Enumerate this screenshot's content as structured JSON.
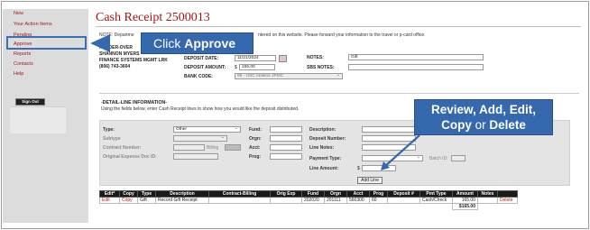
{
  "sidebar": {
    "items": [
      "New",
      "Your Action Items",
      "Pending",
      "Approve",
      "Reports",
      "Contacts",
      "Help"
    ],
    "signout_label": "Sign Out"
  },
  "page": {
    "title": "Cash Receipt 2500013",
    "note_prefix": "NOTE: Departme",
    "note_suffix": "ntered on this website. Please forward your information to the travel or p-card office."
  },
  "callouts": {
    "approve_prefix": "Click ",
    "approve_bold": "Approve",
    "review_line1": "Review, Add, Edit,",
    "review_copy": "Copy",
    "review_or": " or ",
    "review_delete": "Delete"
  },
  "header": {
    "section_label": "HEADER-OVER",
    "contact_name": "SHANNON MYERS",
    "contact_dept": "FINANCE SYSTEMS MGMT LRK",
    "contact_phone": "(806) 743-3604",
    "deposit_date_label": "DEPOSIT DATE:",
    "deposit_date_value": "11/21/2024",
    "deposit_amount_label": "DEPOSIT AMOUNT:",
    "deposit_amount_prefix": "$",
    "deposit_amount_value": "165.00",
    "bank_code_label": "BANK CODE:",
    "bank_code_value": "95 - HSC Abilene JPMC",
    "notes_label": "NOTES:",
    "notes_value": "Gift",
    "sbs_notes_label": "SBS NOTES:",
    "sbs_notes_value": ""
  },
  "detail": {
    "heading": "-DETAIL-LINE INFORMATION-",
    "instructions": "Using the fields below, enter Cash Receipt lines to show how you would like the deposit distributed.",
    "type_label": "Type:",
    "type_value": "Other",
    "subtype_label": "Subtype",
    "contract_label": "Contract Number:",
    "billing_label": "Billing",
    "orig_expense_label": "Original Expense Doc ID:",
    "fund_label": "Fund:",
    "orgn_label": "Orgn:",
    "acct_label": "Acct:",
    "prog_label": "Prog:",
    "description_label": "Description:",
    "deposit_number_label": "Deposit Number:",
    "line_notes_label": "Line Notes:",
    "payment_type_label": "Payment Type:",
    "batch_id_label": "Batch ID:",
    "line_amount_label": "Line Amount:",
    "line_amount_prefix": "$",
    "add_line_label": "Add Line"
  },
  "table": {
    "headers": [
      "Edit*",
      "Copy",
      "Type",
      "Description",
      "Contract-Billing",
      "Orig Exp",
      "Fund",
      "Orgn",
      "Acct",
      "Prog",
      "Deposit #",
      "Pmt Type",
      "Amount",
      "Notes",
      ""
    ],
    "rows": [
      [
        "Edit",
        "Copy",
        "Gift",
        "Record Gift Receipt",
        "",
        "",
        "202020",
        "201111",
        "560300",
        "60",
        "",
        "Cash/Check",
        "165.00",
        "",
        "Delete"
      ]
    ],
    "total": "$165.00"
  },
  "colors": {
    "accent_red": "#a01818",
    "callout_blue": "#3568ad"
  }
}
